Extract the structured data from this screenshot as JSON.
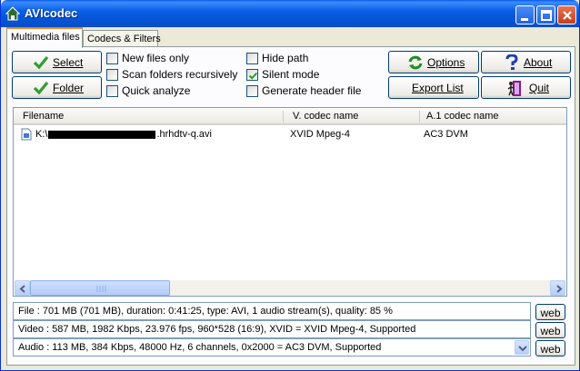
{
  "window": {
    "title": "AVIcodec"
  },
  "tabs": [
    {
      "label": "Multimedia files"
    },
    {
      "label": "Codecs & Filters"
    }
  ],
  "buttons": {
    "select": "Select",
    "folder": "Folder",
    "options": "Options",
    "about": "About",
    "export_list": "Export List",
    "quit": "Quit"
  },
  "checkboxes": [
    {
      "label": "New files only",
      "checked": false
    },
    {
      "label": "Scan folders recursively",
      "checked": false
    },
    {
      "label": "Quick analyze",
      "checked": false
    },
    {
      "label": "Hide path",
      "checked": false
    },
    {
      "label": "Silent mode",
      "checked": true
    },
    {
      "label": "Generate header file",
      "checked": false
    }
  ],
  "list": {
    "columns": [
      "Filename",
      "V. codec name",
      "A.1 codec name"
    ],
    "rows": [
      {
        "filename_prefix": "K:\\",
        "filename_suffix": ".hrhdtv-q.avi",
        "vcodec": "XVID Mpeg-4",
        "acodec": "AC3 DVM"
      }
    ]
  },
  "info": {
    "file": "File    :  701 MB (701 MB),  duration: 0:41:25,  type: AVI,  1 audio stream(s),  quality: 85 %",
    "video": "Video :  587 MB,  1982 Kbps,  23.976 fps,  960*528 (16:9),  XVID = XVID Mpeg-4,    Supported",
    "audio": "Audio :  113 MB,  384 Kbps,  48000 Hz,  6 channels,  0x2000 = AC3 DVM,    Supported"
  },
  "web_label": "web",
  "colors": {
    "title_bar": "#0a5fe4",
    "tab_accent": "#e68b2c",
    "check_green": "#2f9e2f",
    "face": "#ece9d8"
  }
}
